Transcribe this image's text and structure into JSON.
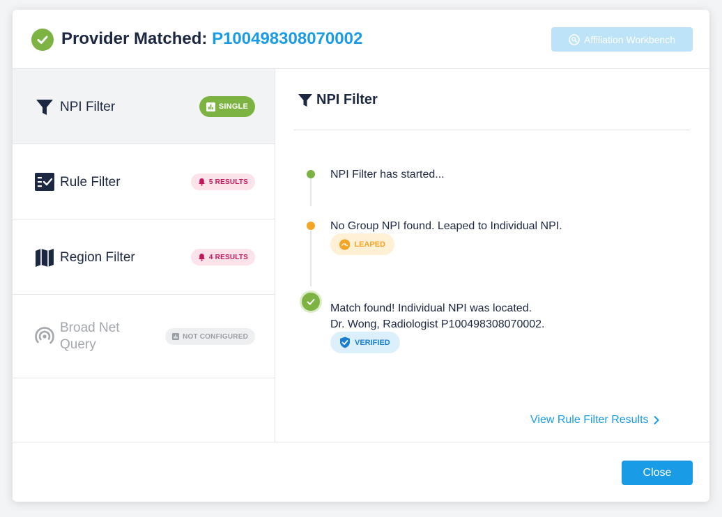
{
  "header": {
    "title": "Provider Matched:",
    "provider_id": "P100498308070002",
    "affiliation_button": "Affiliation Workbench"
  },
  "sidebar": {
    "items": [
      {
        "label": "NPI Filter",
        "badge": "SINGLE",
        "icon": "funnel-icon",
        "active": true
      },
      {
        "label": "Rule Filter",
        "badge": "5 RESULTS",
        "icon": "checklist-icon"
      },
      {
        "label": "Region Filter",
        "badge": "4 RESULTS",
        "icon": "map-icon"
      },
      {
        "label_line1": "Broad Net",
        "label_line2": "Query",
        "badge": "NOT CONFIGURED",
        "icon": "broadcast-icon",
        "disabled": true
      }
    ]
  },
  "main": {
    "heading": "NPI Filter",
    "timeline": [
      {
        "text": "NPI Filter has started...",
        "status": "started"
      },
      {
        "text": "No Group NPI found. Leaped to Individual NPI.",
        "status": "leaped",
        "badge": "LEAPED"
      },
      {
        "text_line1": "Match found! Individual NPI was located.",
        "text_line2": "Dr. Wong, Radiologist P100498308070002.",
        "status": "verified",
        "badge": "VERIFIED"
      }
    ],
    "view_link": "View Rule Filter Results"
  },
  "footer": {
    "close_button": "Close"
  },
  "colors": {
    "accent": "#1a9be6",
    "success": "#7cb342",
    "warning": "#f5a524",
    "danger_badge": "#c2185b",
    "navy": "#1c2741"
  }
}
